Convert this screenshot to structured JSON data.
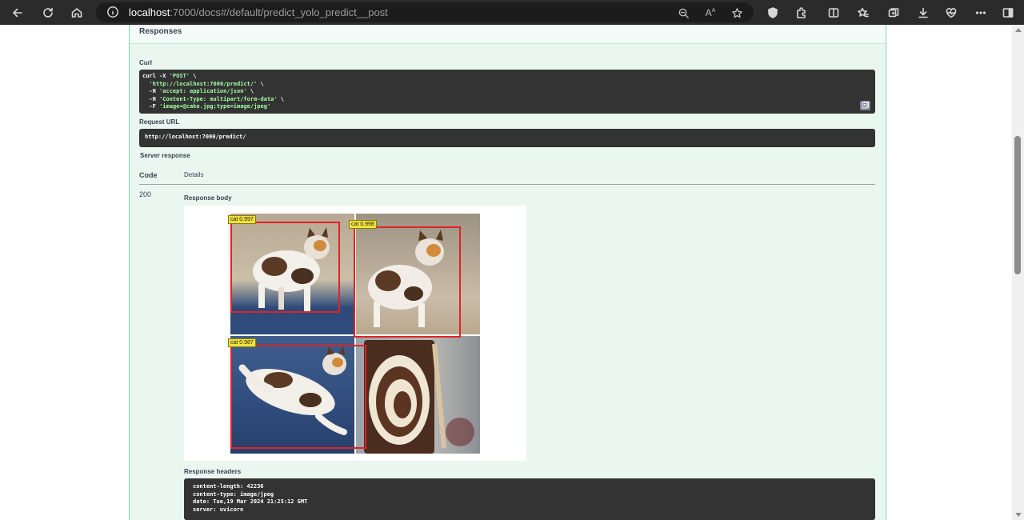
{
  "browser": {
    "url_host": "localhost",
    "url_rest": ":7000/docs#/default/predict_yolo_predict__post"
  },
  "responses": {
    "title": "Responses",
    "curl_label": "Curl",
    "curl_lines": [
      {
        "pre": "curl -X ",
        "str": "'POST'",
        "post": " \\"
      },
      {
        "pre": "  ",
        "str": "'http://localhost:7000/predict/'",
        "post": " \\"
      },
      {
        "pre": "  -H ",
        "str": "'accept: application/json'",
        "post": " \\"
      },
      {
        "pre": "  -H ",
        "str": "'Content-Type: multipart/form-data'",
        "post": " \\"
      },
      {
        "pre": "  -F ",
        "str": "'image=@cake.jpg;type=image/jpeg'",
        "post": ""
      }
    ],
    "request_url_label": "Request URL",
    "request_url": "http://localhost:7000/predict/",
    "server_response_label": "Server response",
    "col_code": "Code",
    "col_details": "Details",
    "status_code": "200",
    "response_body_label": "Response body",
    "detections": [
      {
        "label": "cat 0.997"
      },
      {
        "label": "cat 0.998"
      },
      {
        "label": "cat 0.987"
      }
    ],
    "response_headers_label": "Response headers",
    "headers": [
      "content-length: 42236",
      "content-type: image/jpeg",
      "date: Tue,19 Mar 2024 21:25:12 GMT",
      "server: uvicorn"
    ]
  },
  "colors": {
    "panel_bg": "#eaf7f1",
    "panel_border": "#7ed6b2",
    "code_bg": "#333333",
    "code_string": "#a2fca2",
    "bbox": "#e02424",
    "tag_bg": "#f0e23a"
  }
}
